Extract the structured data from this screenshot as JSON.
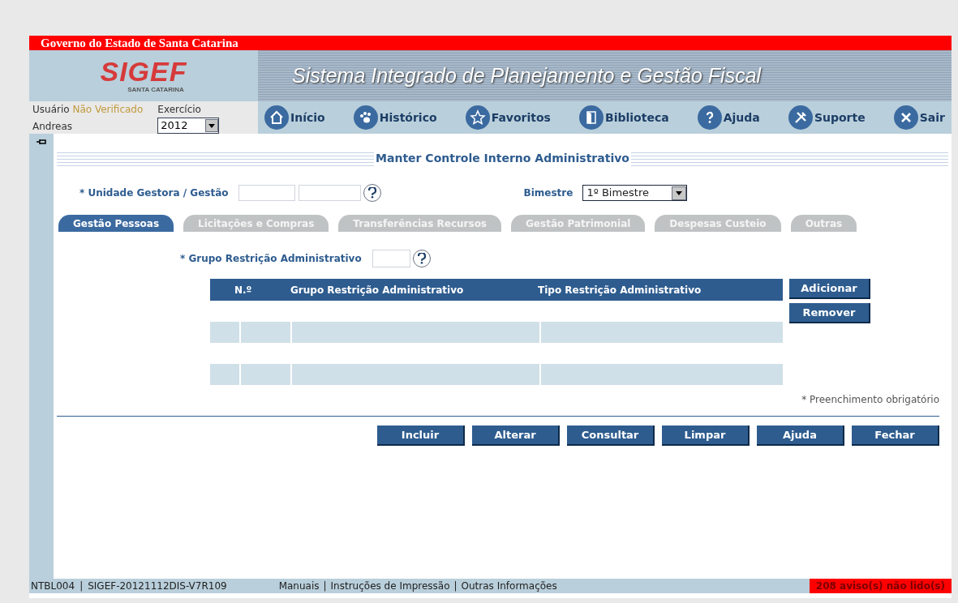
{
  "gov_bar": {
    "title": "Governo do Estado de Santa Catarina"
  },
  "header": {
    "logo": "SIGEF",
    "logo_sub": "SANTA CATARINA",
    "banner": "Sistema Integrado de Planejamento e Gestão Fiscal"
  },
  "user": {
    "label": "Usuário",
    "status": "Não Verificado",
    "name": "Andreas",
    "year_label": "Exercício",
    "year": "2012"
  },
  "nav": [
    {
      "kind": "home",
      "label": "Início"
    },
    {
      "kind": "paw",
      "label": "Histórico"
    },
    {
      "kind": "star",
      "label": "Favoritos"
    },
    {
      "kind": "book",
      "label": "Biblioteca"
    },
    {
      "kind": "help",
      "label": "Ajuda"
    },
    {
      "kind": "tools",
      "label": "Suporte"
    },
    {
      "kind": "close",
      "label": "Sair"
    }
  ],
  "form": {
    "title": "Manter Controle Interno Administrativo",
    "unidade_label": "* Unidade Gestora / Gestão",
    "bimestre_label": "Bimestre",
    "bimestre": "1º Bimestre",
    "tabs": [
      {
        "label": "Gestão Pessoas",
        "selected": true
      },
      {
        "label": "Licitações e Compras",
        "selected": false
      },
      {
        "label": "Transferências Recursos",
        "selected": false
      },
      {
        "label": "Gestão Patrimonial",
        "selected": false
      },
      {
        "label": "Despesas Custeio",
        "selected": false
      },
      {
        "label": "Outras",
        "selected": false
      }
    ],
    "grupo_label": "* Grupo Restrição Administrativo",
    "table": {
      "columns": [
        "N.º",
        "Grupo Restrição Administrativo",
        "Tipo Restrição Administrativo"
      ],
      "rows": [
        {
          "shaded": false
        },
        {
          "shaded": true
        },
        {
          "shaded": false
        },
        {
          "shaded": true
        }
      ]
    },
    "side_buttons": [
      "Adicionar",
      "Remover"
    ],
    "required_note": "* Preenchimento obrigatório",
    "buttons": [
      "Incluir",
      "Alterar",
      "Consultar",
      "Limpar",
      "Ajuda",
      "Fechar"
    ]
  },
  "status_bar": {
    "code": "NTBL004",
    "version": "SIGEF-20121112DIS-V7R109",
    "separators": [
      "|",
      "|",
      "|"
    ],
    "links": [
      "Manuais",
      "Instruções de Impressão",
      "Outras Informações"
    ],
    "alert": "208 aviso(s) não lido(s)"
  }
}
